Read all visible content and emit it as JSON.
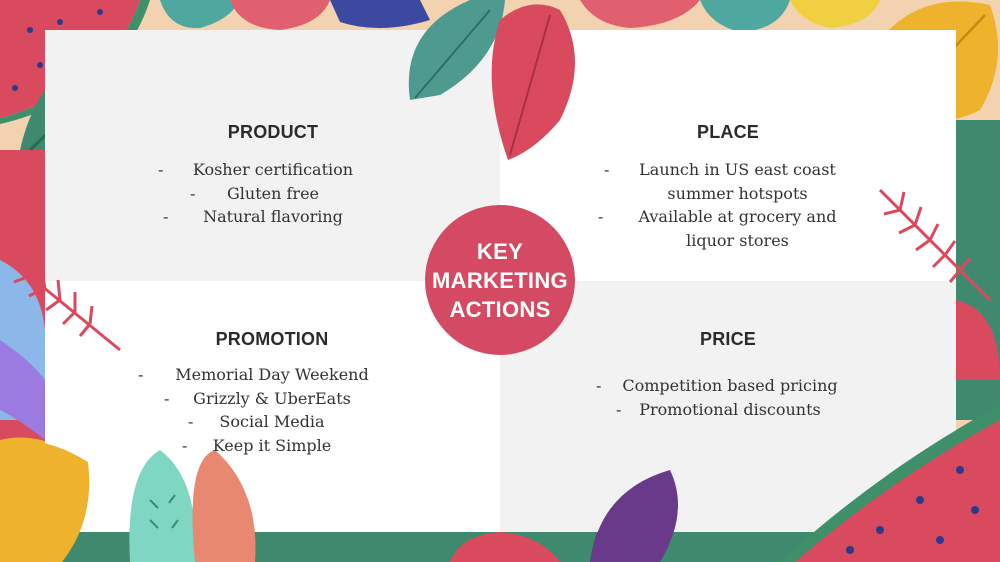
{
  "center": {
    "title": "KEY\nMARKETING\nACTIONS"
  },
  "quadrants": {
    "product": {
      "heading": "PRODUCT",
      "items": [
        "Kosher certification",
        "Gluten free",
        "Natural flavoring"
      ]
    },
    "place": {
      "heading": "PLACE",
      "items": [
        "Launch in US east coast",
        "summer hotspots",
        "Available at grocery and",
        "liquor stores"
      ]
    },
    "promotion": {
      "heading": "PROMOTION",
      "items": [
        "Memorial Day Weekend",
        "Grizzly & UberEats",
        "Social Media",
        "Keep it Simple"
      ]
    },
    "price": {
      "heading": "PRICE",
      "items": [
        "Competition based pricing",
        "Promotional discounts"
      ]
    }
  },
  "colors": {
    "accent": "#d44a62",
    "panel_light": "#f2f2f2",
    "panel_white": "#ffffff",
    "heading_text": "#2b2b2b"
  },
  "icons": [
    "tropical-leaf-icon",
    "watermelon-slice-icon",
    "palm-frond-icon",
    "fern-icon"
  ]
}
